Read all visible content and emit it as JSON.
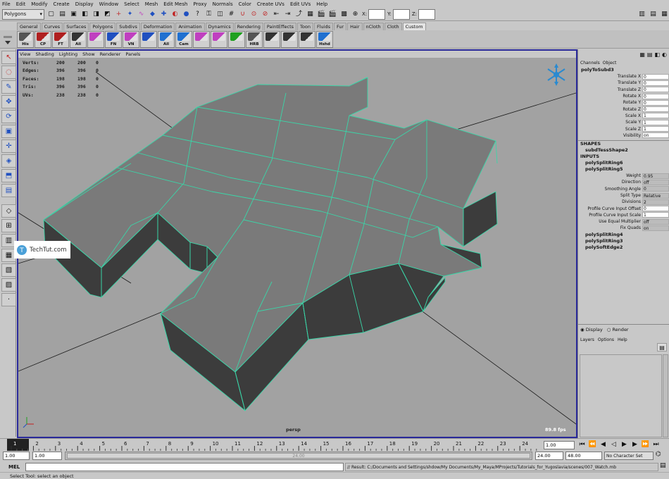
{
  "menu": [
    "File",
    "Edit",
    "Modify",
    "Create",
    "Display",
    "Window",
    "Select",
    "Mesh",
    "Edit Mesh",
    "Proxy",
    "Normals",
    "Color",
    "Create UVs",
    "Edit UVs",
    "Help"
  ],
  "status_line": {
    "mode": "Polygons",
    "x_label": "X:",
    "y_label": "Y:",
    "z_label": "Z:"
  },
  "shelf_tabs": [
    {
      "label": "General",
      "active": false
    },
    {
      "label": "Curves",
      "active": false
    },
    {
      "label": "Surfaces",
      "active": false
    },
    {
      "label": "Polygons",
      "active": false
    },
    {
      "label": "Subdivs",
      "active": false
    },
    {
      "label": "Deformation",
      "active": false
    },
    {
      "label": "Animation",
      "active": false
    },
    {
      "label": "Dynamics",
      "active": false
    },
    {
      "label": "Rendering",
      "active": false
    },
    {
      "label": "PaintEffects",
      "active": false
    },
    {
      "label": "Toon",
      "active": false
    },
    {
      "label": "Fluids",
      "active": false
    },
    {
      "label": "Fur",
      "active": false
    },
    {
      "label": "Hair",
      "active": false
    },
    {
      "label": "nCloth",
      "active": false
    },
    {
      "label": "Cloth",
      "active": false
    },
    {
      "label": "Custom",
      "active": true
    }
  ],
  "shelf_buttons": [
    {
      "label": "His",
      "color": "#555"
    },
    {
      "label": "CP",
      "color": "#b02020"
    },
    {
      "label": "FT",
      "color": "#b02020"
    },
    {
      "label": "All",
      "color": "#333"
    },
    {
      "label": "",
      "color": "#c040c0"
    },
    {
      "label": "FN",
      "color": "#2050c0"
    },
    {
      "label": "VN",
      "color": "#c040c0"
    },
    {
      "label": "",
      "color": "#2050c0"
    },
    {
      "label": "All",
      "color": "#2070d0"
    },
    {
      "label": "Cam",
      "color": "#2070d0"
    },
    {
      "label": "",
      "color": "#c040c0"
    },
    {
      "label": "",
      "color": "#c040c0"
    },
    {
      "label": "",
      "color": "#20a020"
    },
    {
      "label": "HRB",
      "color": "#555"
    },
    {
      "label": "",
      "color": "#333"
    },
    {
      "label": "",
      "color": "#333"
    },
    {
      "label": "",
      "color": "#333"
    },
    {
      "label": "Hshd",
      "color": "#2070d0"
    }
  ],
  "viewport": {
    "menu": [
      "View",
      "Shading",
      "Lighting",
      "Show",
      "Renderer",
      "Panels"
    ],
    "hud": [
      {
        "label": "Verts:",
        "a": "200",
        "b": "200",
        "c": "0"
      },
      {
        "label": "Edges:",
        "a": "396",
        "b": "396",
        "c": "0"
      },
      {
        "label": "Faces:",
        "a": "198",
        "b": "198",
        "c": "0"
      },
      {
        "label": "Tris:",
        "a": "396",
        "b": "396",
        "c": "0"
      },
      {
        "label": "UVs:",
        "a": "238",
        "b": "238",
        "c": "0"
      }
    ],
    "camera": "persp",
    "fps": "89.8 fps",
    "watermark": "TechTut.com"
  },
  "channel_box": {
    "tabs": [
      "Channels",
      "Object"
    ],
    "node": "polyToSubd3",
    "attrs": [
      {
        "name": "Translate X",
        "value": "0"
      },
      {
        "name": "Translate Y",
        "value": "0"
      },
      {
        "name": "Translate Z",
        "value": "0"
      },
      {
        "name": "Rotate X",
        "value": "0"
      },
      {
        "name": "Rotate Y",
        "value": "0"
      },
      {
        "name": "Rotate Z",
        "value": "0"
      },
      {
        "name": "Scale X",
        "value": "1"
      },
      {
        "name": "Scale Y",
        "value": "1"
      },
      {
        "name": "Scale Z",
        "value": "1"
      },
      {
        "name": "Visibility",
        "value": "on"
      }
    ],
    "shapes_header": "SHAPES",
    "shape": "subdTessShape2",
    "inputs_header": "INPUTS",
    "inputs_top": [
      "polySplitRing6",
      "polySplitRing5"
    ],
    "input_attrs": [
      {
        "name": "Weight",
        "value": "0.95",
        "grey": true
      },
      {
        "name": "Direction",
        "value": "off",
        "grey": true
      },
      {
        "name": "Smoothing Angle",
        "value": "0",
        "grey": true
      },
      {
        "name": "Split Type",
        "value": "Relative",
        "grey": true
      },
      {
        "name": "Divisions",
        "value": "2",
        "grey": true
      },
      {
        "name": "Profile Curve Input Offset",
        "value": "0",
        "grey": false
      },
      {
        "name": "Profile Curve Input Scale",
        "value": "1",
        "grey": false
      },
      {
        "name": "Use Equal Multiplier",
        "value": "off",
        "grey": true
      },
      {
        "name": "Fix Quads",
        "value": "on",
        "grey": true
      }
    ],
    "inputs_bottom": [
      "polySplitRing4",
      "polySplitRing3",
      "polySoftEdge2"
    ]
  },
  "layer_editor": {
    "display": "Display",
    "render": "Render",
    "menu": [
      "Layers",
      "Options",
      "Help"
    ]
  },
  "timeline": {
    "ticks": [
      "1",
      "2",
      "3",
      "4",
      "5",
      "6",
      "7",
      "8",
      "9",
      "10",
      "11",
      "12",
      "13",
      "14",
      "15",
      "16",
      "17",
      "18",
      "19",
      "20",
      "21",
      "22",
      "23",
      "24"
    ],
    "current": "1.00"
  },
  "range": {
    "start": "1.00",
    "start_inner": "1.00",
    "end_inner": "24.00",
    "end": "48.00",
    "slider_label": "24.00",
    "character_set": "No Character Set"
  },
  "command": {
    "label": "MEL",
    "result": "// Result: C:/Documents and Settings/shdow/My Documents/My_Maya/MProjects/Tutorials_for_Yugoslavia/scenes/007_Watch.mb"
  },
  "help_line": "Select Tool: select an object",
  "colors": {
    "viewport_bg": "#a2a2a2",
    "wire": "#3ad6a8",
    "face_top": "#7a7a7a",
    "face_side": "#3c3c3c",
    "frame": "#2a2a9a"
  }
}
